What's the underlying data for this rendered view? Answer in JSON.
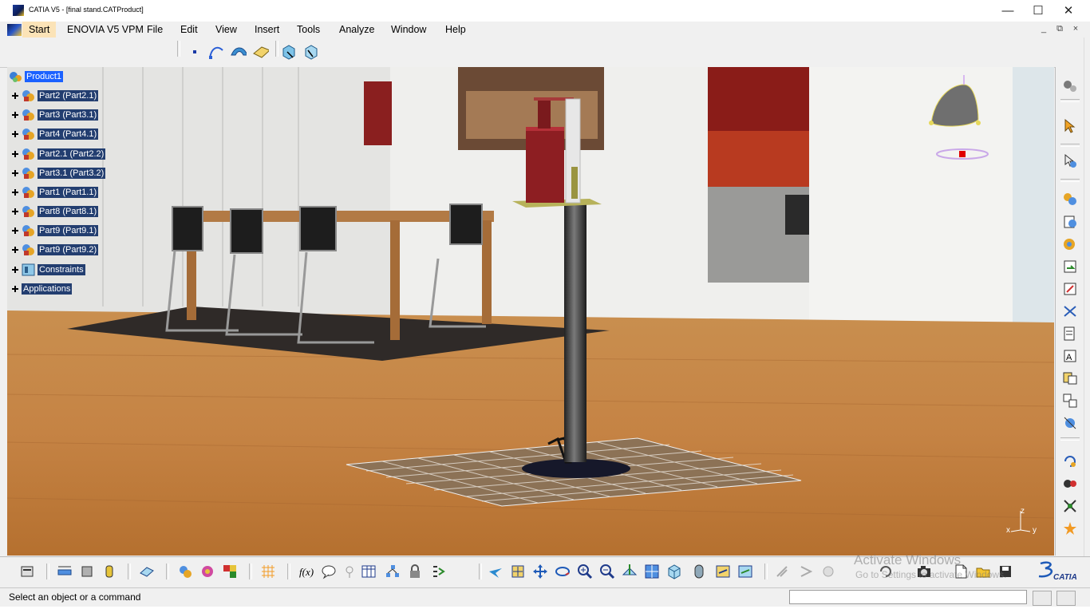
{
  "window": {
    "title": "CATIA V5 - [final stand.CATProduct]",
    "minimize_glyph": "—",
    "maximize_glyph": "☐",
    "close_glyph": "✕"
  },
  "menu": {
    "items": [
      "Start",
      "ENOVIA V5 VPM",
      "File",
      "Edit",
      "View",
      "Insert",
      "Tools",
      "Analyze",
      "Window",
      "Help"
    ],
    "doc_controls": [
      "_",
      "⧉",
      "×"
    ]
  },
  "tree": {
    "root": "Product1",
    "nodes": [
      "Part2 (Part2.1)",
      "Part3 (Part3.1)",
      "Part4 (Part4.1)",
      "Part2.1 (Part2.2)",
      "Part3.1 (Part3.2)",
      "Part1 (Part1.1)",
      "Part8 (Part8.1)",
      "Part9 (Part9.1)",
      "Part9 (Part9.2)",
      "Constraints",
      "Applications"
    ]
  },
  "compass": {
    "x": "x",
    "y": "y",
    "z": "z"
  },
  "watermark": {
    "line1": "Activate Windows",
    "line2": "Go to Settings to activate Windows."
  },
  "status": {
    "text": "Select an object or a command",
    "command_value": ""
  },
  "brand": {
    "logo_text": "CATIA",
    "logo_prefix": "3DS"
  },
  "colors": {
    "tree_label_bg": "#233e70",
    "tree_selected_bg": "#1b61ff",
    "menu_start_bg": "#fbe3b7"
  }
}
